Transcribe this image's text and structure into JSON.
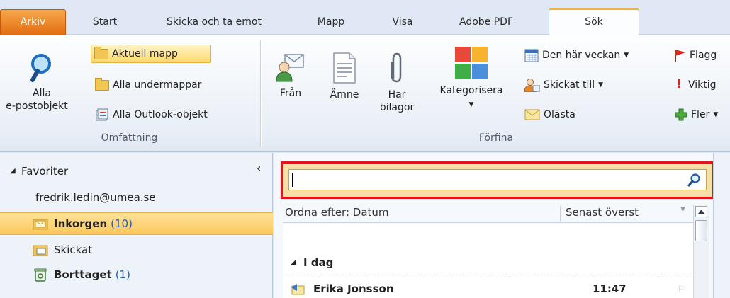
{
  "tabs": [
    {
      "label": "Arkiv"
    },
    {
      "label": "Start"
    },
    {
      "label": "Skicka och ta emot"
    },
    {
      "label": "Mapp"
    },
    {
      "label": "Visa"
    },
    {
      "label": "Adobe PDF"
    },
    {
      "label": "Sök"
    }
  ],
  "ribbon": {
    "scope": {
      "all_items_line1": "Alla",
      "all_items_line2": "e-postobjekt",
      "current_folder": "Aktuell mapp",
      "all_subfolders": "Alla undermappar",
      "all_outlook": "Alla Outlook-objekt",
      "label": "Omfattning"
    },
    "refine": {
      "from": "Från",
      "subject": "Ämne",
      "has_attach_line1": "Har",
      "has_attach_line2": "bilagor",
      "categorize": "Kategorisera",
      "this_week": "Den här veckan",
      "sent_to": "Skickat till",
      "unread": "Olästa",
      "flagged": "Flagg",
      "important": "Viktig",
      "more": "Fler",
      "label": "Förfina"
    }
  },
  "nav": {
    "favorites": "Favoriter",
    "account": "fredrik.ledin@umea.se",
    "inbox": "Inkorgen",
    "inbox_count": "(10)",
    "sent": "Skickat",
    "deleted": "Borttaget",
    "deleted_count": "(1)"
  },
  "list": {
    "search_value": "",
    "sort_by": "Ordna efter: Datum",
    "sort_order": "Senast överst",
    "group_today": "I dag",
    "item1_sender": "Erika Jonsson",
    "item1_time": "11:47"
  },
  "colors": {
    "file_tab": "#e8781a",
    "highlight": "#fbc75b",
    "search_border": "#e0141b"
  }
}
